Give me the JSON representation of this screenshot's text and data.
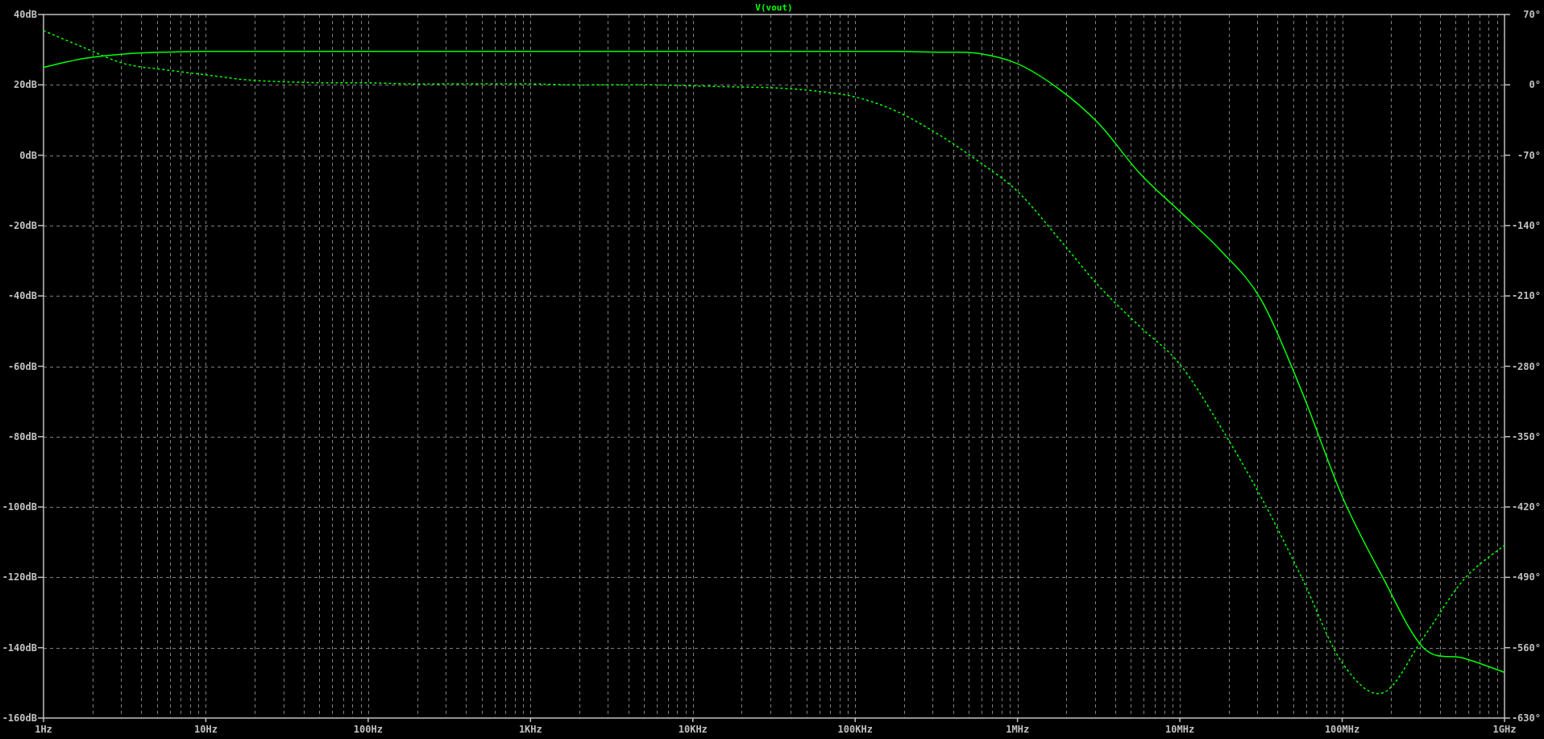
{
  "plot": {
    "magnitude": {
      "chart_data": {
        "type": "line",
        "title": "V(vout)",
        "categories": [
          "1Hz",
          null,
          null,
          null,
          "10Hz",
          null,
          null,
          null,
          "100Hz",
          null,
          null,
          null,
          "1KHz",
          null,
          null,
          null,
          "10KHz",
          null,
          null,
          null,
          "100KHz",
          null,
          null,
          null,
          "1MHz",
          null,
          null,
          null,
          "10MHz",
          null,
          null,
          null,
          "100MHz",
          null,
          null,
          null,
          "1GHz"
        ],
        "series": [
          {
            "color": "#00ff00",
            "line_style": "solid",
            "values": [
              25,
              27.5,
              28.8,
              29.3,
              29.5,
              29.5,
              29.5,
              29.5,
              29.5,
              29.5,
              29.5,
              29.5,
              29.5,
              29.5,
              29.5,
              29.5,
              29.5,
              29.5,
              29.5,
              29.5,
              29.5,
              29.5,
              29.3,
              29,
              26,
              19,
              9,
              -5,
              -16,
              -27,
              -41,
              -67,
              -97,
              -120,
              -140,
              -143,
              -147
            ]
          }
        ],
        "ylim": [
          -160,
          40
        ],
        "yticks": [
          {
            "value": 40,
            "label": "40dB"
          },
          {
            "value": 20,
            "label": "20dB"
          },
          {
            "value": 0,
            "label": "0dB"
          },
          {
            "value": -20,
            "label": "-20dB"
          },
          {
            "value": -40,
            "label": "-40dB"
          },
          {
            "value": -60,
            "label": "-60dB"
          },
          {
            "value": -80,
            "label": "-80dB"
          },
          {
            "value": -100,
            "label": "-100dB"
          },
          {
            "value": -120,
            "label": "-120dB"
          },
          {
            "value": -140,
            "label": "-140dB"
          },
          {
            "value": -160,
            "label": "-160dB"
          }
        ]
      }
    },
    "phase": {
      "chart_data": {
        "type": "line",
        "categories": [
          null,
          null,
          null,
          null,
          null,
          null,
          null,
          null,
          null,
          null,
          null,
          null,
          null,
          null,
          null,
          null,
          null,
          null,
          null,
          null,
          null,
          null,
          null,
          null,
          null,
          null,
          null,
          null,
          null,
          null,
          null,
          null,
          null,
          null,
          null,
          null,
          null
        ],
        "series": [
          {
            "color": "#00ff00",
            "line_style": "dashed",
            "values": [
              54,
              37,
              21,
              15,
              10,
              5,
              3,
              2,
              2,
              1,
              1,
              1,
              1,
              0,
              0,
              0,
              -1,
              -2,
              -3,
              -6,
              -12,
              -26,
              -48,
              -75,
              -106,
              -152,
              -200,
              -240,
              -278,
              -340,
              -410,
              -490,
              -575,
              -605,
              -550,
              -492,
              -458
            ]
          }
        ],
        "ylim": [
          -630,
          70
        ],
        "yticks": [
          {
            "value": 70,
            "label": "70°"
          },
          {
            "value": 0,
            "label": "0°"
          },
          {
            "value": -70,
            "label": "-70°"
          },
          {
            "value": -140,
            "label": "-140°"
          },
          {
            "value": -210,
            "label": "-210°"
          },
          {
            "value": -280,
            "label": "-280°"
          },
          {
            "value": -350,
            "label": "-350°"
          },
          {
            "value": -420,
            "label": "-420°"
          },
          {
            "value": -490,
            "label": "-490°"
          },
          {
            "value": -560,
            "label": "-560°"
          },
          {
            "value": -630,
            "label": "-630°"
          }
        ]
      }
    }
  }
}
